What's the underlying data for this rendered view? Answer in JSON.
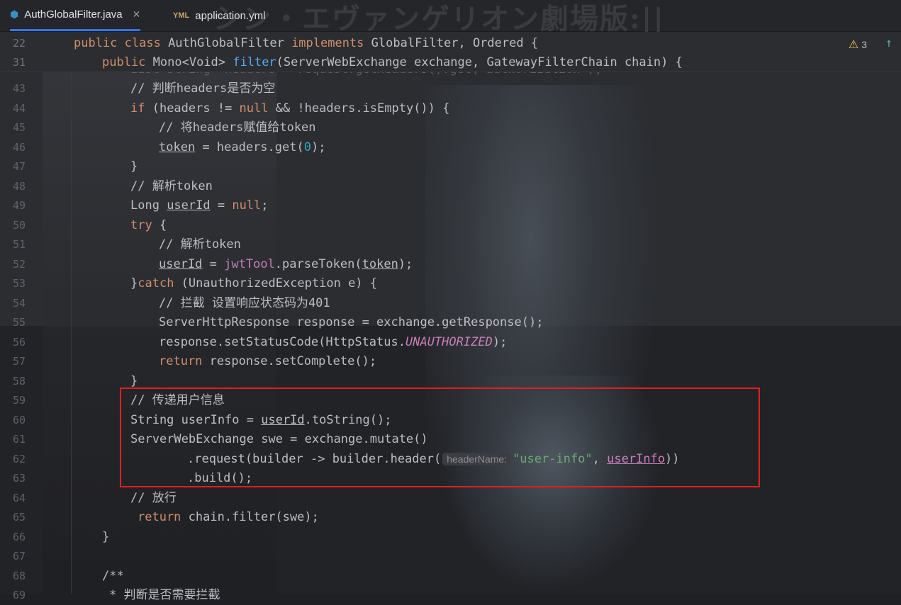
{
  "tabs": [
    {
      "label": "AuthGlobalFilter.java",
      "icon": "java-class-icon",
      "active": true,
      "close": "✕"
    },
    {
      "label": "application.yml",
      "icon": "yml-file-icon",
      "active": false
    }
  ],
  "banner_text": "シン・エヴァンゲリオン劇場版:||",
  "sticky": [
    {
      "num": "22",
      "code": "public class AuthGlobalFilter implements GlobalFilter, Ordered {"
    },
    {
      "num": "31",
      "code": "public Mono<Void> filter(ServerWebExchange exchange, GatewayFilterChain chain) {"
    }
  ],
  "warnings": {
    "count": "3"
  },
  "partial_line": "List<String> headers = request.getHeaders().get(\"authorization\");",
  "lines": [
    {
      "num": "43",
      "c": "// 判断headers是否为空"
    },
    {
      "num": "44",
      "c1": "if",
      "c2": " (headers != ",
      "c3": "null",
      "c4": " && !headers.isEmpty()) {"
    },
    {
      "num": "45",
      "c": "// 将headers赋值给token"
    },
    {
      "num": "46",
      "c1": "token",
      "c2": " = headers.get(",
      "c3": "0",
      "c4": ");"
    },
    {
      "num": "47",
      "c": "}"
    },
    {
      "num": "48",
      "c": "// 解析token"
    },
    {
      "num": "49",
      "c1": "Long ",
      "c2": "userId",
      "c3": " = ",
      "c4": "null",
      "c5": ";"
    },
    {
      "num": "50",
      "c1": "try",
      "c2": " {"
    },
    {
      "num": "51",
      "c": "// 解析token"
    },
    {
      "num": "52",
      "c1": "userId",
      "c2": " = ",
      "c3": "jwtTool",
      "c4": ".parseToken(",
      "c5": "token",
      "c6": ");"
    },
    {
      "num": "53",
      "c1": "}",
      "c2": "catch",
      "c3": " (UnauthorizedException e) {"
    },
    {
      "num": "54",
      "c": "// 拦截 设置响应状态码为401"
    },
    {
      "num": "55",
      "c": "ServerHttpResponse response = exchange.getResponse();"
    },
    {
      "num": "56",
      "c1": "response.setStatusCode(HttpStatus.",
      "c2": "UNAUTHORIZED",
      "c3": ");"
    },
    {
      "num": "57",
      "c1": "return",
      "c2": " response.setComplete();"
    },
    {
      "num": "58",
      "c": "}"
    },
    {
      "num": "59",
      "c": "// 传递用户信息"
    },
    {
      "num": "60",
      "c1": "String userInfo = ",
      "c2": "userId",
      "c3": ".toString();"
    },
    {
      "num": "61",
      "c": "ServerWebExchange swe = exchange.mutate()"
    },
    {
      "num": "62",
      "c1": ".request(builder -> builder.header(",
      "hint": "headerName:",
      "c2": "\"user-info\"",
      "c3": ", ",
      "c4": "userInfo",
      "c5": "))"
    },
    {
      "num": "63",
      "c": ".build();"
    },
    {
      "num": "64",
      "c": "// 放行"
    },
    {
      "num": "65",
      "c1": "return",
      "c2": " chain.filter(swe);"
    },
    {
      "num": "66",
      "c": "}"
    },
    {
      "num": "67",
      "c": ""
    },
    {
      "num": "68",
      "c": "/**"
    },
    {
      "num": "69",
      "c": "* 判断是否需要拦截"
    }
  ],
  "colors": {
    "keyword": "#cf8e6d",
    "comment": "#7a7e85",
    "method": "#56a8f5",
    "string": "#6aab73",
    "number": "#2aacb8",
    "field": "#c77dbb",
    "highlight_border": "#e02020",
    "tab_accent": "#3574f0"
  }
}
